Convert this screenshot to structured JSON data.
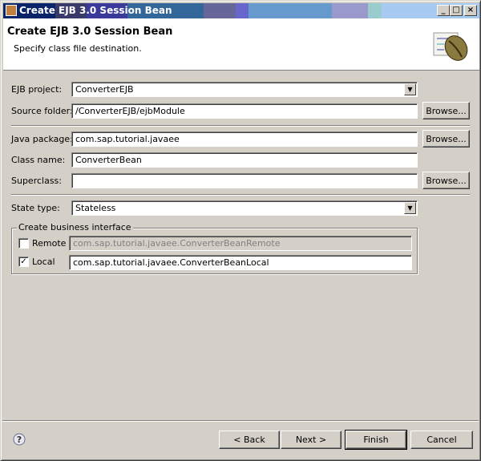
{
  "window": {
    "title": "Create EJB 3.0 Session Bean",
    "minimize": "_",
    "maximize": "□",
    "close": "×"
  },
  "header": {
    "title": "Create EJB 3.0 Session Bean",
    "subtitle": "Specify class file destination.",
    "icon": "session-bean-icon"
  },
  "form": {
    "ejb_project": {
      "label": "EJB project:",
      "value": "ConverterEJB"
    },
    "source_folder": {
      "label": "Source folder:",
      "value": "/ConverterEJB/ejbModule"
    },
    "java_package": {
      "label": "Java package:",
      "value": "com.sap.tutorial.javaee"
    },
    "class_name": {
      "label": "Class name:",
      "value": "ConverterBean"
    },
    "superclass": {
      "label": "Superclass:",
      "value": ""
    },
    "browse_label": "Browse...",
    "state_type": {
      "label": "State type:",
      "value": "Stateless"
    },
    "business_interface": {
      "legend": "Create business interface",
      "remote": {
        "label": "Remote",
        "checked": false,
        "value": "com.sap.tutorial.javaee.ConverterBeanRemote"
      },
      "local": {
        "label": "Local",
        "checked": true,
        "value": "com.sap.tutorial.javaee.ConverterBeanLocal"
      }
    }
  },
  "footer": {
    "back": "< Back",
    "next": "Next >",
    "finish": "Finish",
    "cancel": "Cancel"
  }
}
